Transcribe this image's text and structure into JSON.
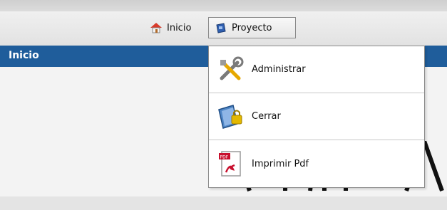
{
  "menubar": {
    "inicio_label": "Inicio",
    "proyecto_label": "Proyecto"
  },
  "header": {
    "title": "Inicio"
  },
  "dropdown": {
    "items": [
      {
        "label": "Administrar",
        "icon": "tools-icon"
      },
      {
        "label": "Cerrar",
        "icon": "lock-book-icon"
      },
      {
        "label": "Imprimir Pdf",
        "icon": "pdf-icon"
      }
    ]
  },
  "colors": {
    "accent": "#1f5d9b"
  }
}
